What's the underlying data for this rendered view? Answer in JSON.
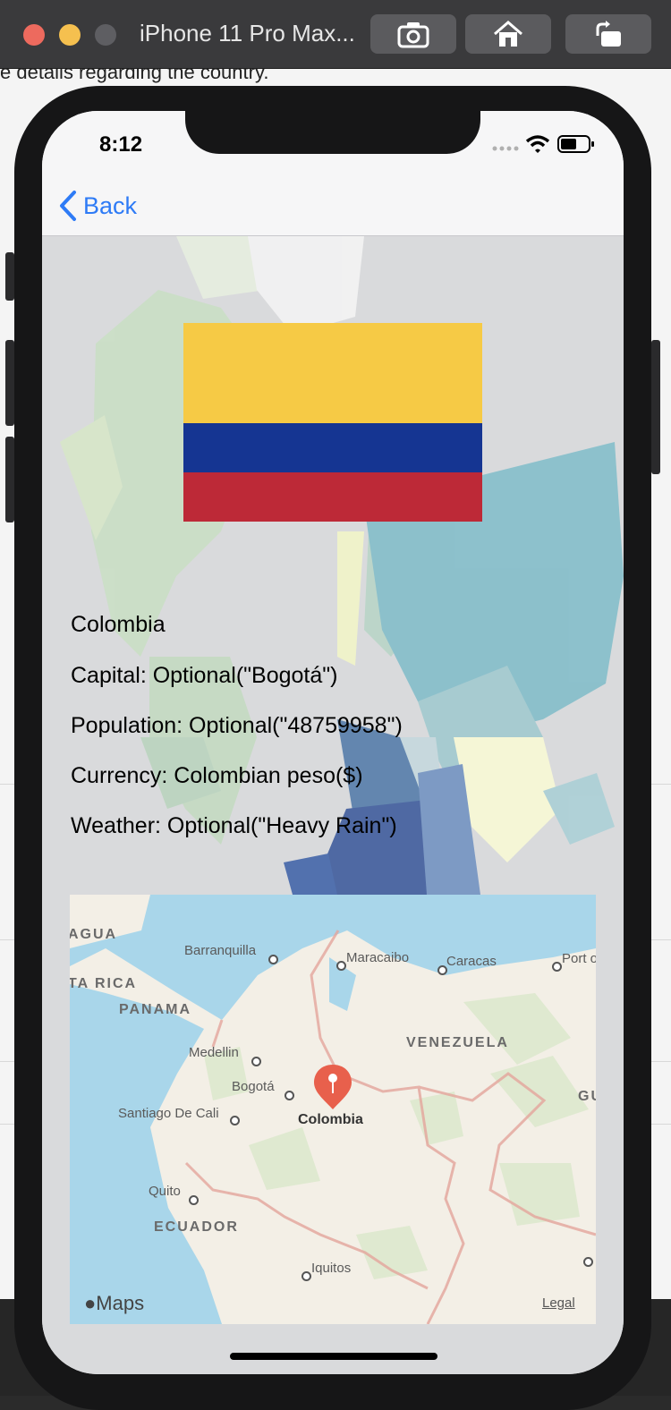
{
  "window": {
    "title": "iPhone 11 Pro Max...",
    "buttons": [
      "screenshot-icon",
      "home-icon",
      "rotate-icon"
    ]
  },
  "status_bar": {
    "time": "8:12"
  },
  "nav": {
    "back_label": "Back"
  },
  "country": {
    "name": "Colombia",
    "capital": "Capital: Optional(\"Bogotá\")",
    "population": "Population: Optional(\"48759958\")",
    "currency": "Currency: Colombian peso($)",
    "weather": "Weather: Optional(\"Heavy Rain\")",
    "flag_colors": [
      "#f6ca45",
      "#153592",
      "#bd2937"
    ]
  },
  "map": {
    "pin_label": "Colombia",
    "cities": [
      "Barranquilla",
      "Maracaibo",
      "Caracas",
      "Port o",
      "Medellin",
      "Bogotá",
      "Santiago De Cali",
      "Quito",
      "Iquitos"
    ],
    "countries": [
      "AGUA",
      "TA RICA",
      "PANAMA",
      "VENEZUELA",
      "GU",
      "ECUADOR"
    ],
    "logo": "Maps",
    "legal": "Legal"
  },
  "background_text": [
    "e details regarding the country."
  ],
  "colors": {
    "accent": "#2e7bf6",
    "pin": "#e8604c",
    "water": "#a9d6ea",
    "land": "#f3efe6"
  }
}
